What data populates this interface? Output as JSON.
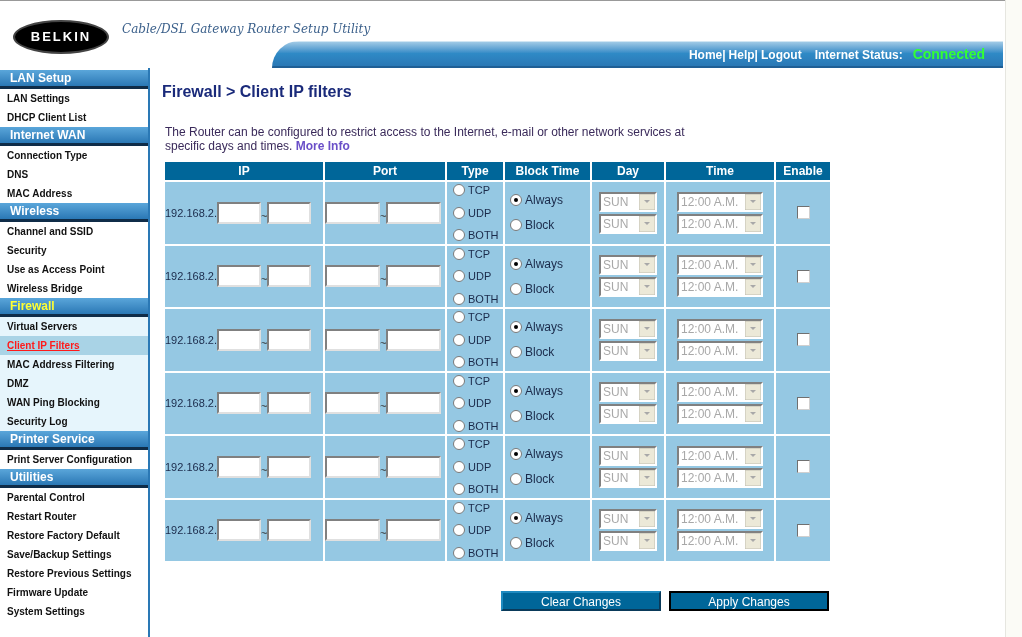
{
  "header": {
    "logo": "BELKIN",
    "tagline": "Cable/DSL Gateway Router Setup Utility",
    "links": [
      "Home|",
      "Help|",
      "Logout"
    ],
    "status_label": "Internet Status:",
    "status_value": "Connected"
  },
  "sidebar": [
    {
      "title": "LAN Setup",
      "selected": false,
      "items": [
        {
          "label": "LAN Settings",
          "selected": false
        },
        {
          "label": "DHCP Client List",
          "selected": false
        }
      ]
    },
    {
      "title": "Internet WAN",
      "selected": false,
      "items": [
        {
          "label": "Connection Type",
          "selected": false
        },
        {
          "label": "DNS",
          "selected": false
        },
        {
          "label": "MAC Address",
          "selected": false
        }
      ]
    },
    {
      "title": "Wireless",
      "selected": false,
      "items": [
        {
          "label": "Channel and SSID",
          "selected": false
        },
        {
          "label": "Security",
          "selected": false
        },
        {
          "label": "Use as Access Point",
          "selected": false
        },
        {
          "label": "Wireless Bridge",
          "selected": false
        }
      ]
    },
    {
      "title": "Firewall",
      "selected": true,
      "items": [
        {
          "label": "Virtual Servers",
          "selected": false
        },
        {
          "label": "Client IP Filters",
          "selected": true
        },
        {
          "label": "MAC Address Filtering",
          "selected": false
        },
        {
          "label": "DMZ",
          "selected": false
        },
        {
          "label": "WAN Ping Blocking",
          "selected": false
        },
        {
          "label": "Security Log",
          "selected": false
        }
      ]
    },
    {
      "title": "Printer Service",
      "selected": false,
      "items": [
        {
          "label": "Print Server Configuration",
          "selected": false
        }
      ]
    },
    {
      "title": "Utilities",
      "selected": false,
      "items": [
        {
          "label": "Parental Control",
          "selected": false
        },
        {
          "label": "Restart Router",
          "selected": false
        },
        {
          "label": "Restore Factory Default",
          "selected": false
        },
        {
          "label": "Save/Backup Settings",
          "selected": false
        },
        {
          "label": "Restore Previous Settings",
          "selected": false
        },
        {
          "label": "Firmware Update",
          "selected": false
        },
        {
          "label": "System Settings",
          "selected": false
        }
      ]
    }
  ],
  "page_title": "Firewall > Client IP filters",
  "intro": "The Router can be configured to restrict access to the Internet, e-mail or other network services at specific days and times.",
  "more_info": "More Info",
  "table": {
    "columns": [
      "IP",
      "Port",
      "Type",
      "Block Time",
      "Day",
      "Time",
      "Enable"
    ],
    "rows": [
      {
        "ip_prefix": "192.168.2.",
        "ip_separator": "~",
        "port_separator": "~",
        "types": [
          {
            "label": "TCP",
            "selected": false
          },
          {
            "label": "UDP",
            "selected": false
          },
          {
            "label": "BOTH",
            "selected": false
          }
        ],
        "block_time": [
          {
            "label": "Always",
            "selected": true
          },
          {
            "label": "Block",
            "selected": false
          }
        ],
        "days": [
          "SUN",
          "SUN"
        ],
        "times": [
          "12:00 A.M.",
          "12:00 A.M."
        ],
        "schedule_disabled": true,
        "enabled": false
      },
      {
        "ip_prefix": "192.168.2.",
        "ip_separator": "~",
        "port_separator": "~",
        "types": [
          {
            "label": "TCP",
            "selected": false
          },
          {
            "label": "UDP",
            "selected": false
          },
          {
            "label": "BOTH",
            "selected": false
          }
        ],
        "block_time": [
          {
            "label": "Always",
            "selected": true
          },
          {
            "label": "Block",
            "selected": false
          }
        ],
        "days": [
          "SUN",
          "SUN"
        ],
        "times": [
          "12:00 A.M.",
          "12:00 A.M."
        ],
        "schedule_disabled": true,
        "enabled": false
      },
      {
        "ip_prefix": "192.168.2.",
        "ip_separator": "~",
        "port_separator": "~",
        "types": [
          {
            "label": "TCP",
            "selected": false
          },
          {
            "label": "UDP",
            "selected": false
          },
          {
            "label": "BOTH",
            "selected": false
          }
        ],
        "block_time": [
          {
            "label": "Always",
            "selected": true
          },
          {
            "label": "Block",
            "selected": false
          }
        ],
        "days": [
          "SUN",
          "SUN"
        ],
        "times": [
          "12:00 A.M.",
          "12:00 A.M."
        ],
        "schedule_disabled": true,
        "enabled": false
      },
      {
        "ip_prefix": "192.168.2.",
        "ip_separator": "~",
        "port_separator": "~",
        "types": [
          {
            "label": "TCP",
            "selected": false
          },
          {
            "label": "UDP",
            "selected": false
          },
          {
            "label": "BOTH",
            "selected": false
          }
        ],
        "block_time": [
          {
            "label": "Always",
            "selected": true
          },
          {
            "label": "Block",
            "selected": false
          }
        ],
        "days": [
          "SUN",
          "SUN"
        ],
        "times": [
          "12:00 A.M.",
          "12:00 A.M."
        ],
        "schedule_disabled": true,
        "enabled": false
      },
      {
        "ip_prefix": "192.168.2.",
        "ip_separator": "~",
        "port_separator": "~",
        "types": [
          {
            "label": "TCP",
            "selected": false
          },
          {
            "label": "UDP",
            "selected": false
          },
          {
            "label": "BOTH",
            "selected": false
          }
        ],
        "block_time": [
          {
            "label": "Always",
            "selected": true
          },
          {
            "label": "Block",
            "selected": false
          }
        ],
        "days": [
          "SUN",
          "SUN"
        ],
        "times": [
          "12:00 A.M.",
          "12:00 A.M."
        ],
        "schedule_disabled": true,
        "enabled": false
      },
      {
        "ip_prefix": "192.168.2.",
        "ip_separator": "~",
        "port_separator": "~",
        "types": [
          {
            "label": "TCP",
            "selected": false
          },
          {
            "label": "UDP",
            "selected": false
          },
          {
            "label": "BOTH",
            "selected": false
          }
        ],
        "block_time": [
          {
            "label": "Always",
            "selected": true
          },
          {
            "label": "Block",
            "selected": false
          }
        ],
        "days": [
          "SUN",
          "SUN"
        ],
        "times": [
          "12:00 A.M.",
          "12:00 A.M."
        ],
        "schedule_disabled": true,
        "enabled": false
      }
    ]
  },
  "buttons": [
    "Clear Changes",
    "Apply Changes"
  ]
}
